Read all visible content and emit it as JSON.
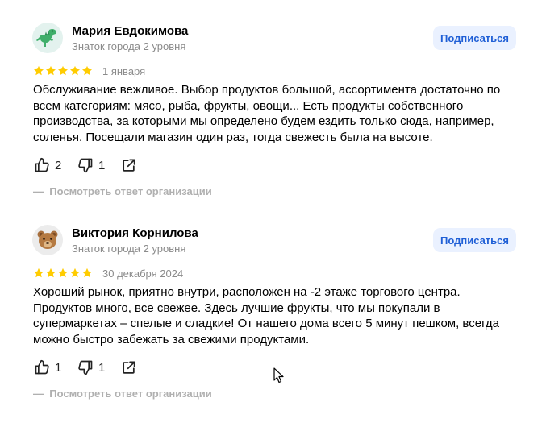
{
  "reviews": [
    {
      "author": "Мария Евдокимова",
      "level": "Знаток города 2 уровня",
      "subscribe_label": "Подписаться",
      "avatar_icon": "dinosaur-icon",
      "rating": 5,
      "date": "1 января",
      "text": "Обслуживание вежливое. Выбор продуктов большой, ассортимента достаточно по всем категориям: мясо, рыба, фрукты, овощи... Есть продукты собственного производства, за которыми мы определено будем ездить только сюда, например, соленья. Посещали магазин один раз, тогда свежесть была на высоте.",
      "likes": "2",
      "dislikes": "1",
      "org_reply_label": "Посмотреть ответ организации"
    },
    {
      "author": "Виктория Корнилова",
      "level": "Знаток города 2 уровня",
      "subscribe_label": "Подписаться",
      "avatar_icon": "bear-icon",
      "rating": 5,
      "date": "30 декабря 2024",
      "text": "Хороший рынок, приятно внутри, расположен на -2 этаже торгового центра. Продуктов много, все свежее. Здесь лучшие фрукты, что мы покупали в супермаркетах – спелые и сладкие! От нашего дома всего 5 минут пешком, всегда можно быстро забежать за свежими продуктами.",
      "likes": "1",
      "dislikes": "1",
      "org_reply_label": "Посмотреть ответ организации"
    }
  ],
  "colors": {
    "star": "#fc0",
    "subscribe_bg": "#eaf1ff",
    "subscribe_text": "#1f5fd6",
    "muted": "#8b8b8b",
    "org_link": "#b0b0b0"
  },
  "icons": {
    "like": "thumbs-up-icon",
    "dislike": "thumbs-down-icon",
    "share": "share-icon",
    "cursor": "mouse-pointer-icon"
  }
}
